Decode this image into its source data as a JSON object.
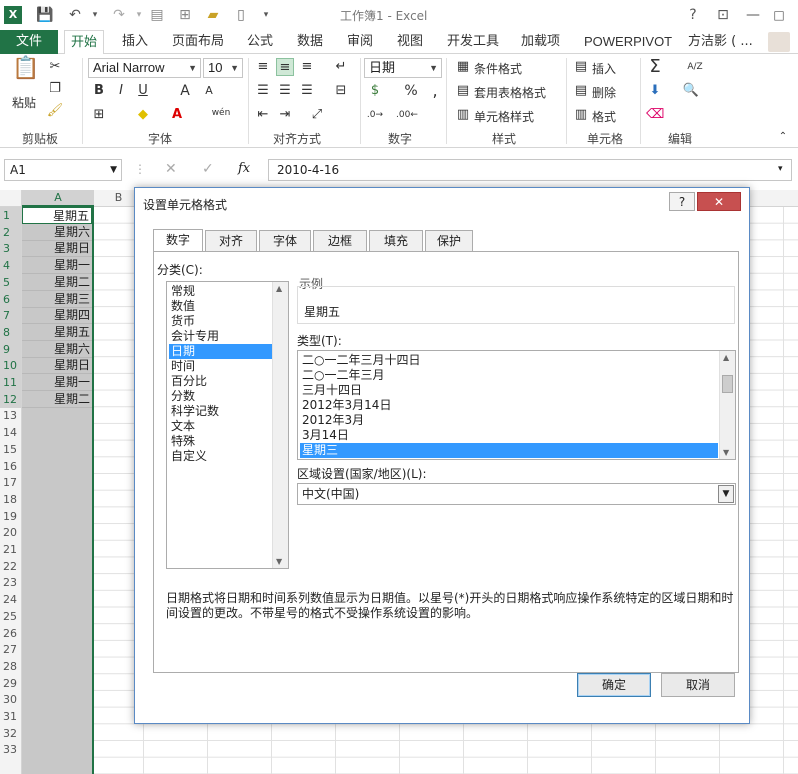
{
  "window": {
    "title": "工作簿1 - Excel",
    "help": "?",
    "minimize": "—",
    "maximize": "□",
    "close": "✕",
    "quick_access": [
      "save-icon",
      "undo-icon",
      "redo-icon"
    ]
  },
  "tabs": [
    "文件",
    "开始",
    "插入",
    "页面布局",
    "公式",
    "数据",
    "审阅",
    "视图",
    "开发工具",
    "加载项",
    "POWERPIVOT",
    "方洁影 ( ..."
  ],
  "ribbon": {
    "clipboard": {
      "paste": "粘贴",
      "label": "剪贴板"
    },
    "font": {
      "name": "Arial Narrow",
      "size": "10",
      "label": "字体",
      "bold": "B",
      "italic": "I",
      "underline": "U",
      "grow": "A",
      "shrink": "A",
      "pinyin": "wén"
    },
    "alignment": {
      "label": "对齐方式"
    },
    "number": {
      "format": "日期",
      "label": "数字",
      "percent": "%",
      "comma": ","
    },
    "styles": {
      "conditional": "条件格式",
      "table": "套用表格格式",
      "cell": "单元格样式",
      "label": "样式"
    },
    "cells": {
      "insert": "插入",
      "delete": "删除",
      "format": "格式",
      "label": "单元格"
    },
    "editing": {
      "label": "编辑",
      "sum": "Σ",
      "sort": "A/Z"
    }
  },
  "formula_bar": {
    "name_box": "A1",
    "cancel": "✕",
    "enter": "✓",
    "fx": "fx",
    "value": "2010-4-16"
  },
  "grid": {
    "columns": [
      "A",
      "B"
    ],
    "rows": [
      "1",
      "2",
      "3",
      "4",
      "5",
      "6",
      "7",
      "8",
      "9",
      "10",
      "11",
      "12",
      "13",
      "14",
      "15",
      "16",
      "17",
      "18",
      "19",
      "20",
      "21",
      "22",
      "23",
      "24",
      "25",
      "26",
      "27",
      "28",
      "29",
      "30",
      "31",
      "32",
      "33"
    ],
    "colA_values": [
      "星期五",
      "星期六",
      "星期日",
      "星期一",
      "星期二",
      "星期三",
      "星期四",
      "星期五",
      "星期六",
      "星期日",
      "星期一",
      "星期二"
    ]
  },
  "dialog": {
    "title": "设置单元格格式",
    "help": "?",
    "close": "✕",
    "tabs": [
      "数字",
      "对齐",
      "字体",
      "边框",
      "填充",
      "保护"
    ],
    "category_label": "分类(C):",
    "categories": [
      "常规",
      "数值",
      "货币",
      "会计专用",
      "日期",
      "时间",
      "百分比",
      "分数",
      "科学记数",
      "文本",
      "特殊",
      "自定义"
    ],
    "selected_category": "日期",
    "sample_label": "示例",
    "sample_value": "星期五",
    "type_label": "类型(T):",
    "types": [
      "二○一二年三月十四日",
      "二○一二年三月",
      "三月十四日",
      "2012年3月14日",
      "2012年3月",
      "3月14日",
      "星期三"
    ],
    "selected_type": "星期三",
    "locale_label": "区域设置(国家/地区)(L):",
    "locale_value": "中文(中国)",
    "description": "日期格式将日期和时间系列数值显示为日期值。以星号(*)开头的日期格式响应操作系统特定的区域日期和时间设置的更改。不带星号的格式不受操作系统设置的影响。",
    "ok": "确定",
    "cancel": "取消"
  }
}
